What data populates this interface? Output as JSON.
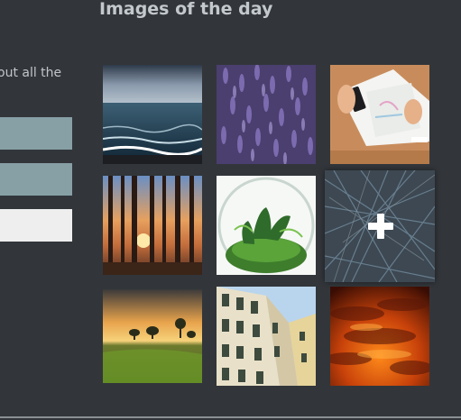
{
  "gallery": {
    "title": "Images of the day"
  },
  "sidebar": {
    "truncated_text": "out all the"
  },
  "tiles": [
    {
      "name": "sea"
    },
    {
      "name": "lavender"
    },
    {
      "name": "desk"
    },
    {
      "name": "forest"
    },
    {
      "name": "terrarium"
    },
    {
      "name": "abstract-lines",
      "overlay_icon": "plus-icon"
    },
    {
      "name": "field"
    },
    {
      "name": "building"
    },
    {
      "name": "sunset-sky"
    }
  ]
}
